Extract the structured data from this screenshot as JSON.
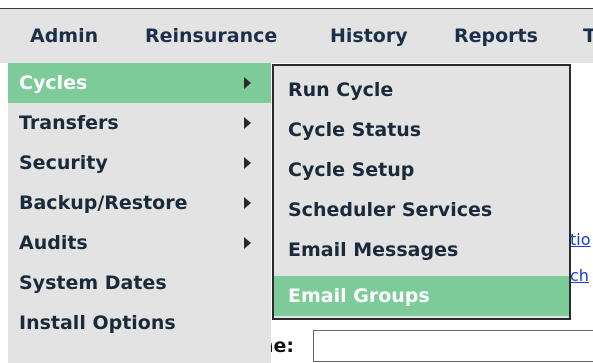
{
  "menubar": {
    "items": [
      "Admin",
      "Reinsurance",
      "History",
      "Reports",
      "T"
    ]
  },
  "admin_menu": {
    "items": [
      {
        "label": "Cycles",
        "has_submenu": true,
        "active": true
      },
      {
        "label": "Transfers",
        "has_submenu": true,
        "active": false
      },
      {
        "label": "Security",
        "has_submenu": true,
        "active": false
      },
      {
        "label": "Backup/Restore",
        "has_submenu": true,
        "active": false
      },
      {
        "label": "Audits",
        "has_submenu": true,
        "active": false
      },
      {
        "label": "System Dates",
        "has_submenu": false,
        "active": false
      },
      {
        "label": "Install Options",
        "has_submenu": false,
        "active": false
      }
    ]
  },
  "cycles_submenu": {
    "items": [
      {
        "label": "Run Cycle",
        "active": false
      },
      {
        "label": "Cycle Status",
        "active": false
      },
      {
        "label": "Cycle Setup",
        "active": false
      },
      {
        "label": "Scheduler Services",
        "active": false
      },
      {
        "label": "Email Messages",
        "active": false
      },
      {
        "label": "Email Groups",
        "active": true
      }
    ]
  },
  "background": {
    "link_1": "tio",
    "link_2": "ch",
    "field_label": "ne:"
  },
  "colors": {
    "menubar_bg": "#e3e3e3",
    "highlight": "#7ccb98",
    "menu_text": "#1a2a3a"
  }
}
